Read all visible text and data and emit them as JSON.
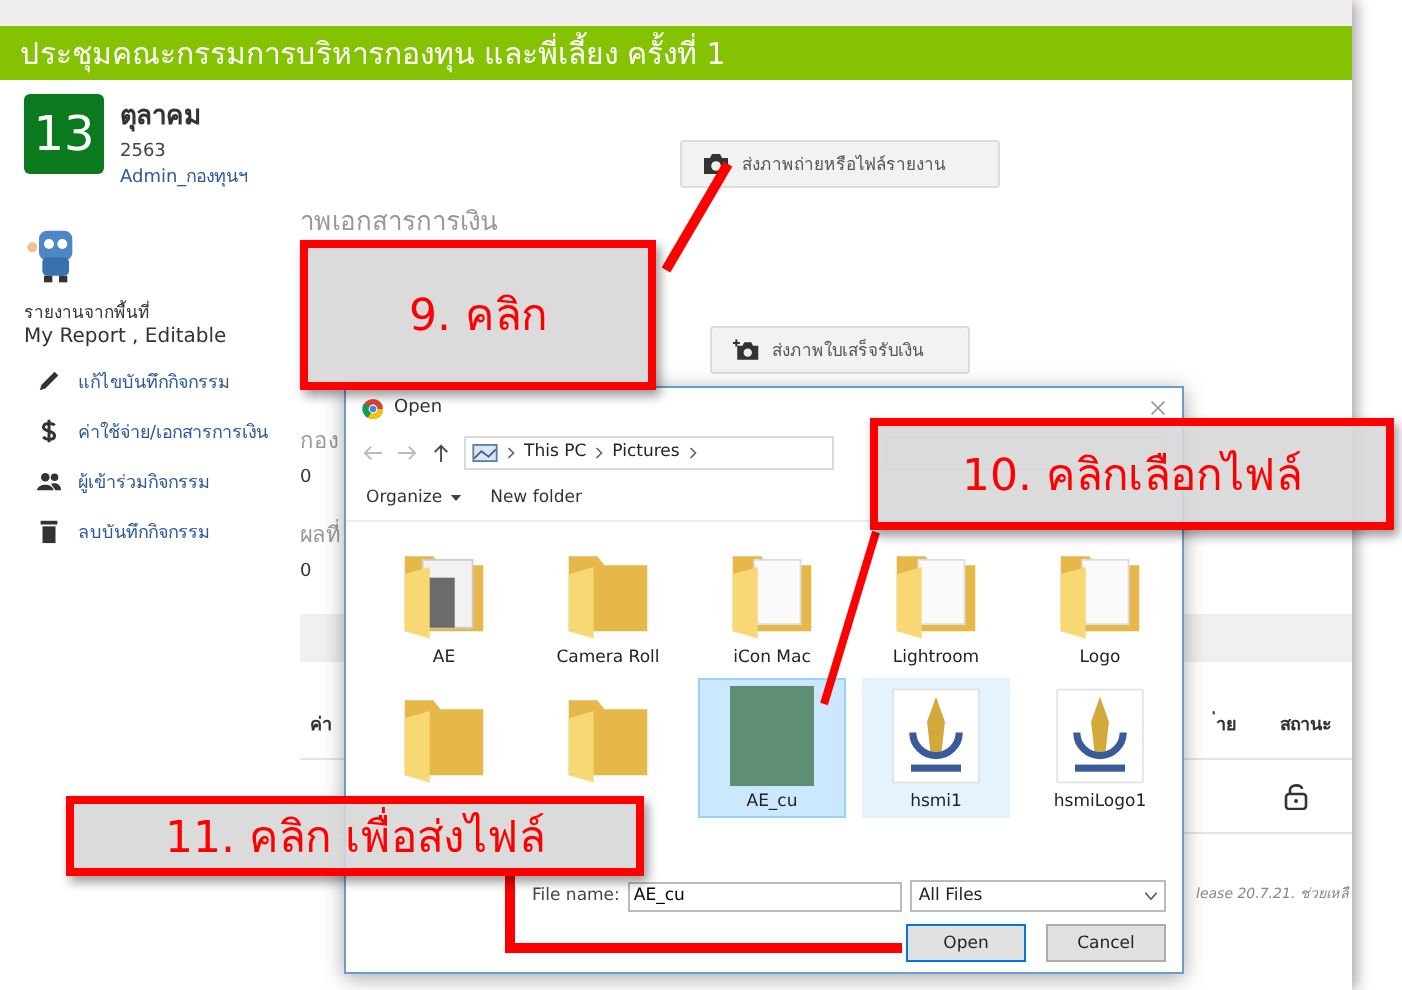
{
  "page": {
    "title": "ประชุมคณะกรรมการบริหารกองทุน และพี่เลี้ยง ครั้งที่ 1"
  },
  "date": {
    "day": "13",
    "month": "ตุลาคม",
    "year": "2563",
    "author": "Admin_กองทุนฯ"
  },
  "report": {
    "caption": "รายงานจากพื้นที่",
    "mode": "My Report , Editable"
  },
  "menu": [
    {
      "kind": "pencil",
      "label": "แก้ไขบันทึกกิจกรรม"
    },
    {
      "kind": "dollar",
      "label": "ค่าใช้จ่าย/เอกสารการเงิน"
    },
    {
      "kind": "people",
      "label": "ผู้เข้าร่วมกิจกรรม"
    },
    {
      "kind": "trash",
      "label": "ลบบันทึกกิจกรรม"
    }
  ],
  "upload_buttons": [
    {
      "kind": "camera",
      "label": "ส่งภาพถ่ายหรือไฟล์รายงาน"
    },
    {
      "kind": "camera-plus",
      "label": "ส่งภาพใบเสร็จรับเงิน"
    }
  ],
  "section_heading": "าพเอกสารการเงิน",
  "stats": [
    {
      "label": "กอง",
      "value": "0"
    },
    {
      "label": "ผลที่",
      "value": "0"
    }
  ],
  "table": {
    "columns": [
      "ค่า",
      "่าย",
      "สถานะ"
    ],
    "rows": [
      {
        "locked": false
      }
    ]
  },
  "footer": "lease 20.7.21. ช่วยเหลื",
  "dialog": {
    "title": "Open",
    "path": [
      "This PC",
      "Pictures"
    ],
    "toolbar": [
      {
        "label": "Organize",
        "dropdown": true
      },
      {
        "label": "New folder",
        "dropdown": false
      }
    ],
    "files": [
      {
        "name": "AE",
        "kind": "folder-photo",
        "selected": false,
        "hovered": false
      },
      {
        "name": "Camera Roll",
        "kind": "folder",
        "selected": false,
        "hovered": false
      },
      {
        "name": "iCon Mac",
        "kind": "folder-doc",
        "selected": false,
        "hovered": false
      },
      {
        "name": "Lightroom",
        "kind": "folder-doc",
        "selected": false,
        "hovered": false
      },
      {
        "name": "Logo",
        "kind": "folder-doc",
        "selected": false,
        "hovered": false
      },
      {
        "kind": "folder",
        "selected": false,
        "hovered": false
      },
      {
        "kind": "folder",
        "selected": false,
        "hovered": false
      },
      {
        "name": "AE_cu",
        "kind": "photo",
        "selected": true,
        "hovered": false
      },
      {
        "name": "hsmi1",
        "kind": "logo",
        "selected": false,
        "hovered": true
      },
      {
        "name": "hsmiLogo1",
        "kind": "logo",
        "selected": false,
        "hovered": false
      }
    ],
    "file_name_label": "File name:",
    "file_name": "AE_cu",
    "file_type": "All Files",
    "buttons": [
      "Open",
      "Cancel"
    ]
  },
  "callouts": [
    {
      "text": "9. คลิก"
    },
    {
      "text": "10. คลิกเลือกไฟล์"
    },
    {
      "text": "11. คลิก เพื่อส่งไฟล์"
    }
  ]
}
